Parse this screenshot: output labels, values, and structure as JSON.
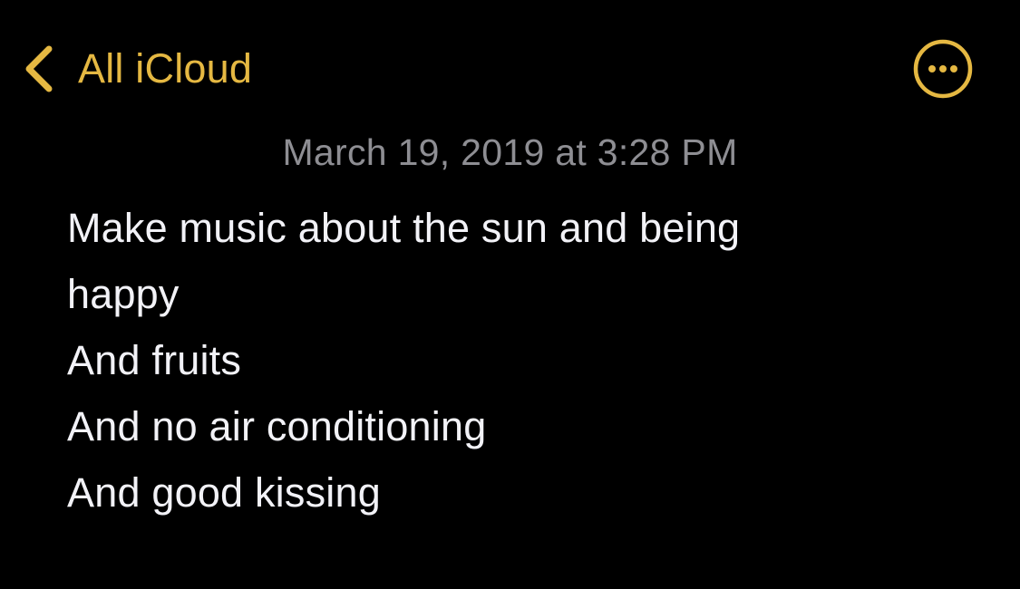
{
  "colors": {
    "background": "#000000",
    "accent": "#E5B842",
    "date_text": "#8E8E93",
    "body_text": "#F2F2F7"
  },
  "nav": {
    "back_icon": "chevron-left-icon",
    "back_label": "All iCloud",
    "more_icon": "ellipsis-circle-icon"
  },
  "note": {
    "date": "March 19, 2019 at 3:28 PM",
    "lines": [
      "Make music about the sun and being",
      "happy",
      "And fruits",
      "And no air conditioning",
      "And good kissing"
    ]
  }
}
